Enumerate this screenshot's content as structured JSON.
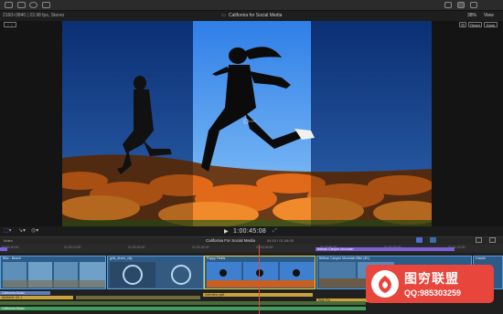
{
  "toolbar": {
    "zoom_label": "38%",
    "view_label": "View"
  },
  "viewer": {
    "format_label": "2160×3840 | 23.98 fps, Stereo",
    "project_title": "California for Social Media",
    "reset_label": "Reset",
    "done_label": "Done"
  },
  "playback": {
    "timecode": "1:00:45:08"
  },
  "timeline": {
    "index_label": "Index",
    "project_name": "California For Social Media",
    "duration": "04:15 / 01:08:05",
    "ruler_ticks": [
      "00:00:00:00",
      "01:00:10:00",
      "01:00:20:00",
      "01:00:30:00",
      "01:00:40:00",
      "01:00:50:00",
      "01:01:00:00",
      "01:01:10:00"
    ],
    "storyline_title": "Beltran Canyon Mountain",
    "clips": [
      {
        "title": "Bike - Beach"
      },
      {
        "title": "girls_drone_clip"
      },
      {
        "title": "Poppy Fields"
      },
      {
        "title": "Beltran Canyon Mountain Bike (4K)"
      },
      {
        "title": "Lincoln"
      }
    ],
    "lanes": [
      {
        "label": "California Music",
        "color": "#5b7fc4"
      },
      {
        "label": "Ambient: Ch 1",
        "color": "#c9a33a"
      },
      {
        "label": "Interview split",
        "color": "#c9a33a"
      },
      {
        "label": "Ride Rd",
        "color": "#c9a33a"
      },
      {
        "label": "California Music",
        "color": "#3fa05a"
      }
    ]
  },
  "watermark": {
    "title": "图穷联盟",
    "subtitle": "QQ:985303259"
  },
  "colors": {
    "accent": "#7b5fd6",
    "clip_blue": "#3b6fa3",
    "selection_yellow": "#e8d23a",
    "playhead": "#e04a3a"
  }
}
